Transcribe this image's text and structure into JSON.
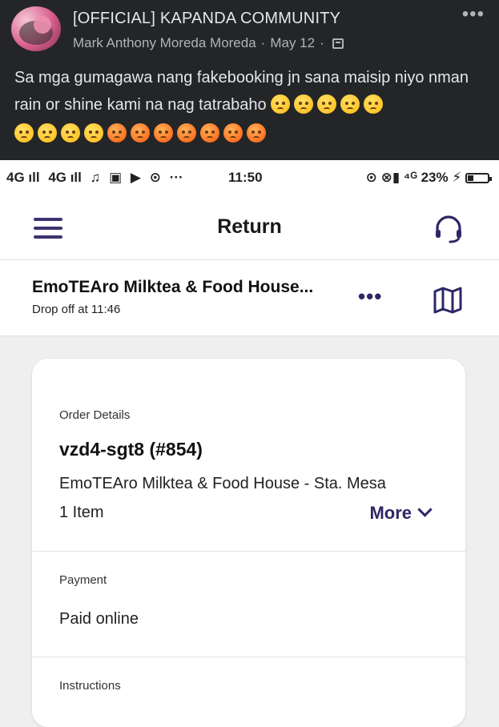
{
  "post": {
    "group_name": "[OFFICIAL] KAPANDA COMMUNITY",
    "author": "Mark Anthony Moreda Moreda",
    "date": "May 12",
    "more_label": "•••",
    "text": "Sa mga gumagawa nang fakebooking jn sana maisip niyo nman rain or shine kami na nag tatrabaho",
    "emoji_icon": "angry-face-emoji",
    "emoji_count": 15
  },
  "statusbar": {
    "left": [
      "4G ıll",
      "4G ıll",
      "♫",
      "▣",
      "▶",
      "⊙",
      "···"
    ],
    "time": "11:50",
    "right_text": "⊙ ⊗▮ ⁴ᴳ 23% ⚡"
  },
  "header": {
    "title": "Return",
    "menu_icon": "hamburger-menu-icon",
    "support_icon": "headset-icon"
  },
  "store": {
    "name": "EmoTEAro Milktea & Food House...",
    "dropoff": "Drop off at 11:46",
    "more_label": "•••",
    "map_icon": "map-icon"
  },
  "order": {
    "section_label": "Order Details",
    "id": "vzd4-sgt8 (#854)",
    "store_full": "EmoTEAro Milktea & Food House - Sta. Mesa",
    "items": "1 Item",
    "more_label": "More"
  },
  "payment": {
    "label": "Payment",
    "value": "Paid online"
  },
  "instructions": {
    "label": "Instructions"
  },
  "colors": {
    "accent": "#2d2766",
    "fb_dark": "#242526",
    "background": "#efefef"
  }
}
